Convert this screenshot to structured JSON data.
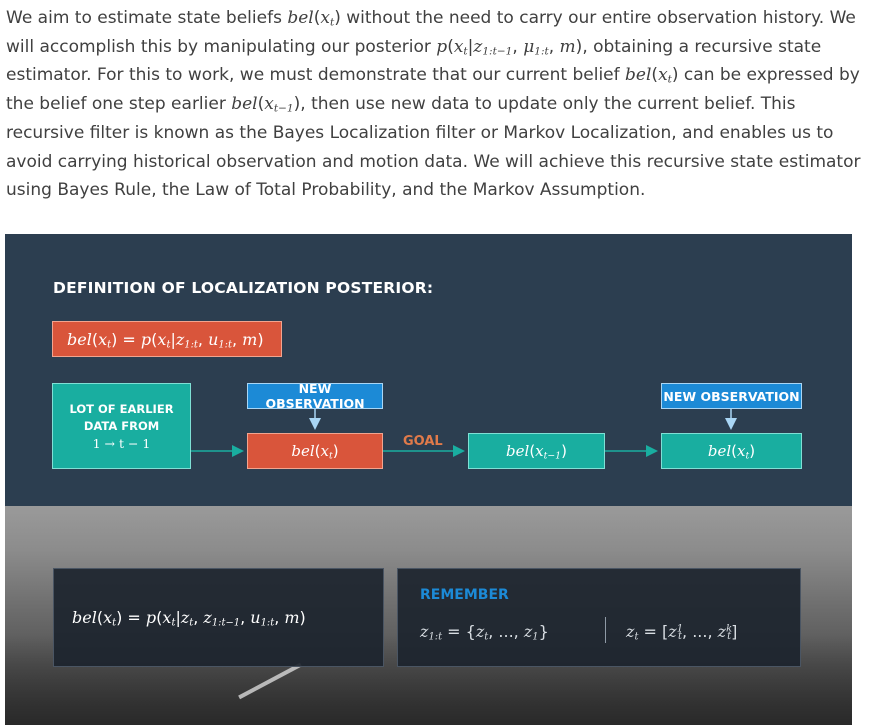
{
  "intro": {
    "p1": "We aim to estimate state beliefs ",
    "p2": " without the need to carry our entire observation history. We will accomplish this by manipulating our posterior ",
    "p3": ", obtaining a recursive state estimator. For this to work, we must demonstrate that our current belief ",
    "p4": " can be expressed by the belief one step earlier ",
    "p5": ", then use new data to update only the current belief. This recursive filter is known as the Bayes Localization filter or Markov Localization, and enables us to avoid carrying historical observation and motion data. We will achieve this recursive state estimator using Bayes Rule, the Law of Total Probability, and the Markov Assumption."
  },
  "figure": {
    "title": "DEFINITION OF LOCALIZATION POSTERIOR:",
    "earlier_line1": "LOT OF EARLIER",
    "earlier_line2": "DATA FROM",
    "earlier_line3": "1 → t − 1",
    "new_observation_1": "NEW OBSERVATION",
    "new_observation_2": "NEW OBSERVATION",
    "goal": "GOAL",
    "remember": "REMEMBER"
  },
  "colors": {
    "panel": "#2c3e50",
    "red": "#d9553b",
    "teal": "#19aea0",
    "blue": "#1c8ad6",
    "goal": "#e07a4a"
  }
}
